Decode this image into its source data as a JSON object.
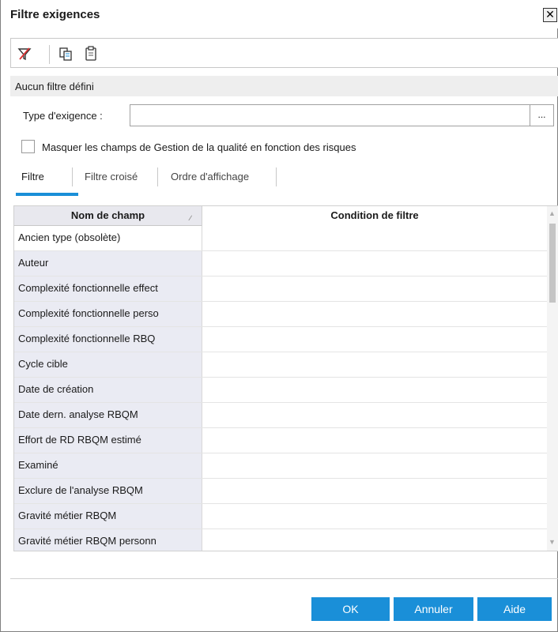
{
  "dialog": {
    "title": "Filtre exigences",
    "close_glyph": "✕"
  },
  "toolbar": {
    "icons": [
      "clear-filter-icon",
      "copy-icon",
      "paste-icon"
    ]
  },
  "status": {
    "text": "Aucun filtre défini"
  },
  "type_field": {
    "label": "Type d'exigence :",
    "value": "",
    "browse_label": "..."
  },
  "risk_checkbox": {
    "label": "Masquer les champs de Gestion de la qualité en fonction des risques",
    "checked": false
  },
  "tabs": [
    {
      "label": "Filtre",
      "active": true
    },
    {
      "label": "Filtre croisé",
      "active": false
    },
    {
      "label": "Ordre d'affichage",
      "active": false
    }
  ],
  "grid": {
    "columns": [
      "Nom de champ",
      "Condition de filtre"
    ],
    "rows": [
      {
        "name": "Ancien type (obsolète)",
        "condition": ""
      },
      {
        "name": "Auteur",
        "condition": ""
      },
      {
        "name": "Complexité fonctionnelle effect",
        "condition": ""
      },
      {
        "name": "Complexité fonctionnelle perso",
        "condition": ""
      },
      {
        "name": "Complexité fonctionnelle RBQ",
        "condition": ""
      },
      {
        "name": "Cycle cible",
        "condition": ""
      },
      {
        "name": "Date de création",
        "condition": ""
      },
      {
        "name": "Date dern. analyse RBQM",
        "condition": ""
      },
      {
        "name": "Effort de RD RBQM estimé",
        "condition": ""
      },
      {
        "name": "Examiné",
        "condition": ""
      },
      {
        "name": "Exclure de l'analyse RBQM",
        "condition": ""
      },
      {
        "name": "Gravité métier RBQM",
        "condition": ""
      },
      {
        "name": "Gravité métier RBQM personn",
        "condition": ""
      }
    ]
  },
  "buttons": {
    "ok": "OK",
    "cancel": "Annuler",
    "help": "Aide"
  },
  "colors": {
    "accent": "#1a8fd8",
    "header_bg": "#e8e8ee",
    "name_col_bg": "#eaebf3"
  }
}
